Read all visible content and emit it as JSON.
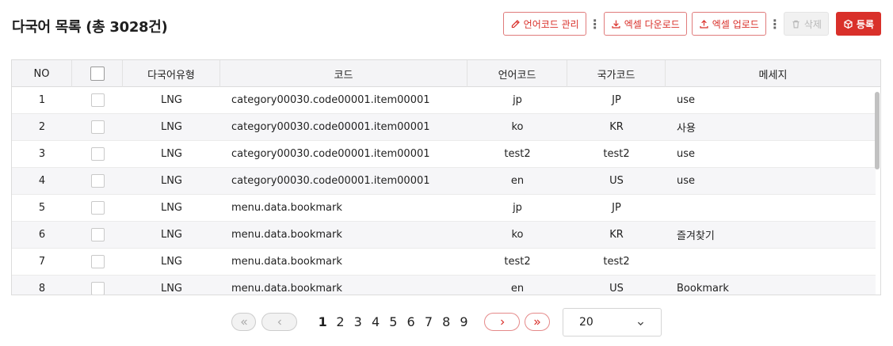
{
  "header": {
    "title": "다국어 목록 (총 3028건)",
    "buttons": {
      "lang_code_manage": "언어코드 관리",
      "excel_download": "엑셀 다운로드",
      "excel_upload": "엑셀 업로드",
      "delete": "삭제",
      "register": "등록"
    },
    "kebab": "⋮"
  },
  "table": {
    "columns": {
      "no": "NO",
      "type": "다국어유형",
      "code": "코드",
      "lang": "언어코드",
      "country": "국가코드",
      "message": "메세지"
    },
    "rows": [
      {
        "no": "1",
        "type": "LNG",
        "code": "category00030.code00001.item00001",
        "lang": "jp",
        "country": "JP",
        "message": "use"
      },
      {
        "no": "2",
        "type": "LNG",
        "code": "category00030.code00001.item00001",
        "lang": "ko",
        "country": "KR",
        "message": "사용"
      },
      {
        "no": "3",
        "type": "LNG",
        "code": "category00030.code00001.item00001",
        "lang": "test2",
        "country": "test2",
        "message": "use"
      },
      {
        "no": "4",
        "type": "LNG",
        "code": "category00030.code00001.item00001",
        "lang": "en",
        "country": "US",
        "message": "use"
      },
      {
        "no": "5",
        "type": "LNG",
        "code": "menu.data.bookmark",
        "lang": "jp",
        "country": "JP",
        "message": ""
      },
      {
        "no": "6",
        "type": "LNG",
        "code": "menu.data.bookmark",
        "lang": "ko",
        "country": "KR",
        "message": "즐겨찾기"
      },
      {
        "no": "7",
        "type": "LNG",
        "code": "menu.data.bookmark",
        "lang": "test2",
        "country": "test2",
        "message": ""
      },
      {
        "no": "8",
        "type": "LNG",
        "code": "menu.data.bookmark",
        "lang": "en",
        "country": "US",
        "message": "Bookmark"
      }
    ]
  },
  "pagination": {
    "pages": [
      "1",
      "2",
      "3",
      "4",
      "5",
      "6",
      "7",
      "8",
      "9"
    ],
    "current": "1",
    "page_size": "20"
  },
  "colors": {
    "accent": "#d9302a",
    "header_bg": "#f4f4f6",
    "row_alt_bg": "#f6f6f8"
  }
}
